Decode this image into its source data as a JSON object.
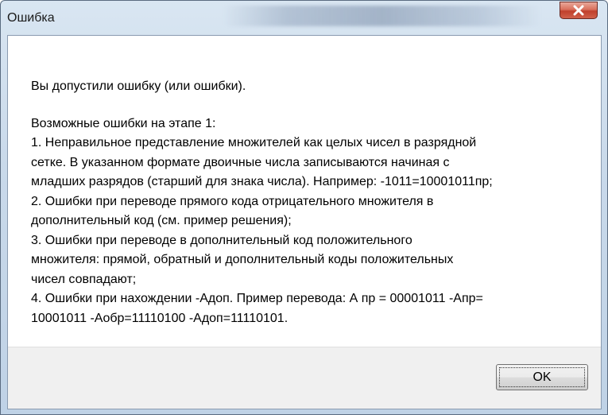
{
  "window": {
    "title": "Ошибка"
  },
  "message": {
    "intro": "Вы допустили ошибку (или ошибки).",
    "lines": [
      "Возможные ошибки на этапе 1:",
      "1. Неправильное представление множителей как целых чисел в разрядной",
      "сетке. В указанном формате двоичные числа записываются начиная с",
      "младших разрядов (старший для знака числа). Например: -1011=10001011пр;",
      "2. Ошибки при переводе прямого кода отрицательного множителя в",
      "дополнительный код (см. пример решения);",
      "3. Ошибки при переводе в дополнительный код положительного",
      "множителя: прямой, обратный и дополнительный коды  положительных",
      "чисел совпадают;",
      "4. Ошибки при нахождении -Адоп. Пример перевода: А пр = 00001011 -Апр=",
      "10001011 -Аобр=11110100 -Адоп=11110101."
    ]
  },
  "buttons": {
    "ok_label": "OK"
  },
  "icons": {
    "close": "close-icon"
  },
  "colors": {
    "close_button": "#c9503c",
    "titlebar": "#c9d9ea"
  }
}
